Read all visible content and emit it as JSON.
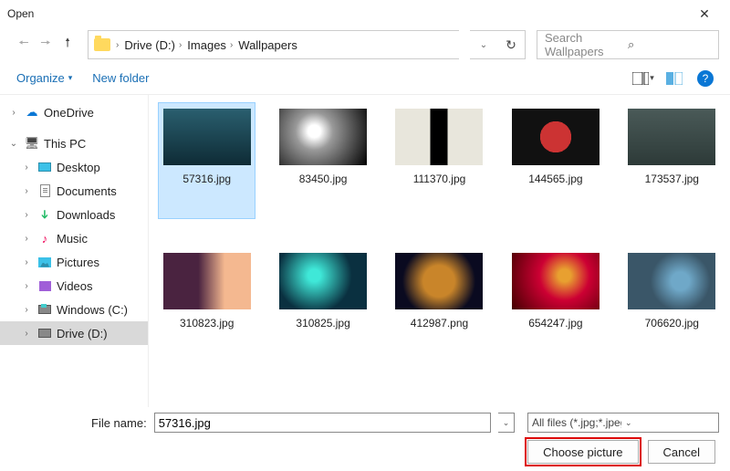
{
  "window": {
    "title": "Open"
  },
  "breadcrumbs": [
    "Drive (D:)",
    "Images",
    "Wallpapers"
  ],
  "search": {
    "placeholder": "Search Wallpapers"
  },
  "toolbar": {
    "organize": "Organize",
    "newfolder": "New folder"
  },
  "sidebar": {
    "onedrive": "OneDrive",
    "thispc": "This PC",
    "desktop": "Desktop",
    "documents": "Documents",
    "downloads": "Downloads",
    "music": "Music",
    "pictures": "Pictures",
    "videos": "Videos",
    "windrive": "Windows (C:)",
    "ddrive": "Drive (D:)"
  },
  "files": [
    {
      "name": "57316.jpg",
      "selected": true
    },
    {
      "name": "83450.jpg",
      "selected": false
    },
    {
      "name": "111370.jpg",
      "selected": false
    },
    {
      "name": "144565.jpg",
      "selected": false
    },
    {
      "name": "173537.jpg",
      "selected": false
    },
    {
      "name": "310823.jpg",
      "selected": false
    },
    {
      "name": "310825.jpg",
      "selected": false
    },
    {
      "name": "412987.png",
      "selected": false
    },
    {
      "name": "654247.jpg",
      "selected": false
    },
    {
      "name": "706620.jpg",
      "selected": false
    }
  ],
  "filename": {
    "label": "File name:",
    "value": "57316.jpg"
  },
  "filter": "All files (*.jpg;*.jpeg;*.bmp;*.dib;*.png;*.jfif;*",
  "buttons": {
    "choose": "Choose picture",
    "cancel": "Cancel"
  }
}
